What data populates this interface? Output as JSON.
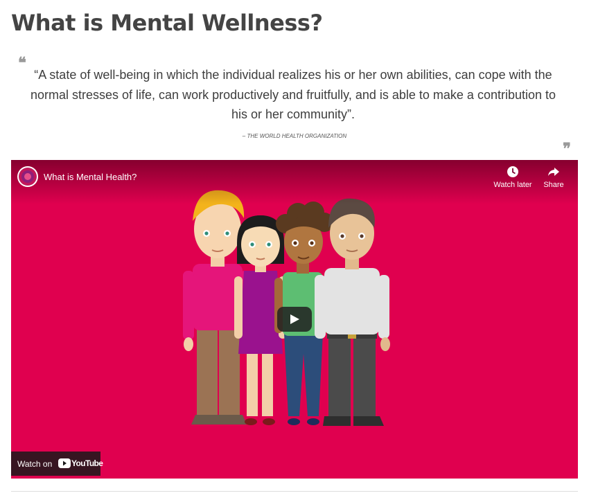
{
  "page": {
    "title": "What is Mental Wellness?"
  },
  "quote": {
    "text": "“A state of well-being in which the individual realizes his or her own abilities, can cope with the normal stresses of life, can work productively and fruitfully, and is able to make a contribution to his or her community”.",
    "source": "– THE WORLD HEALTH ORGANIZATION",
    "open_mark": "❝",
    "close_mark": "❞"
  },
  "video": {
    "title": "What is Mental Health?",
    "background_color": "#e0004f",
    "actions": {
      "watch_later": "Watch later",
      "share": "Share"
    },
    "watch_on": "Watch on",
    "youtube_brand": "YouTube",
    "icons": {
      "channel": "channel-logo-icon",
      "watch_later": "clock-icon",
      "share": "share-arrow-icon",
      "play": "play-icon",
      "youtube": "youtube-logo-icon"
    }
  }
}
